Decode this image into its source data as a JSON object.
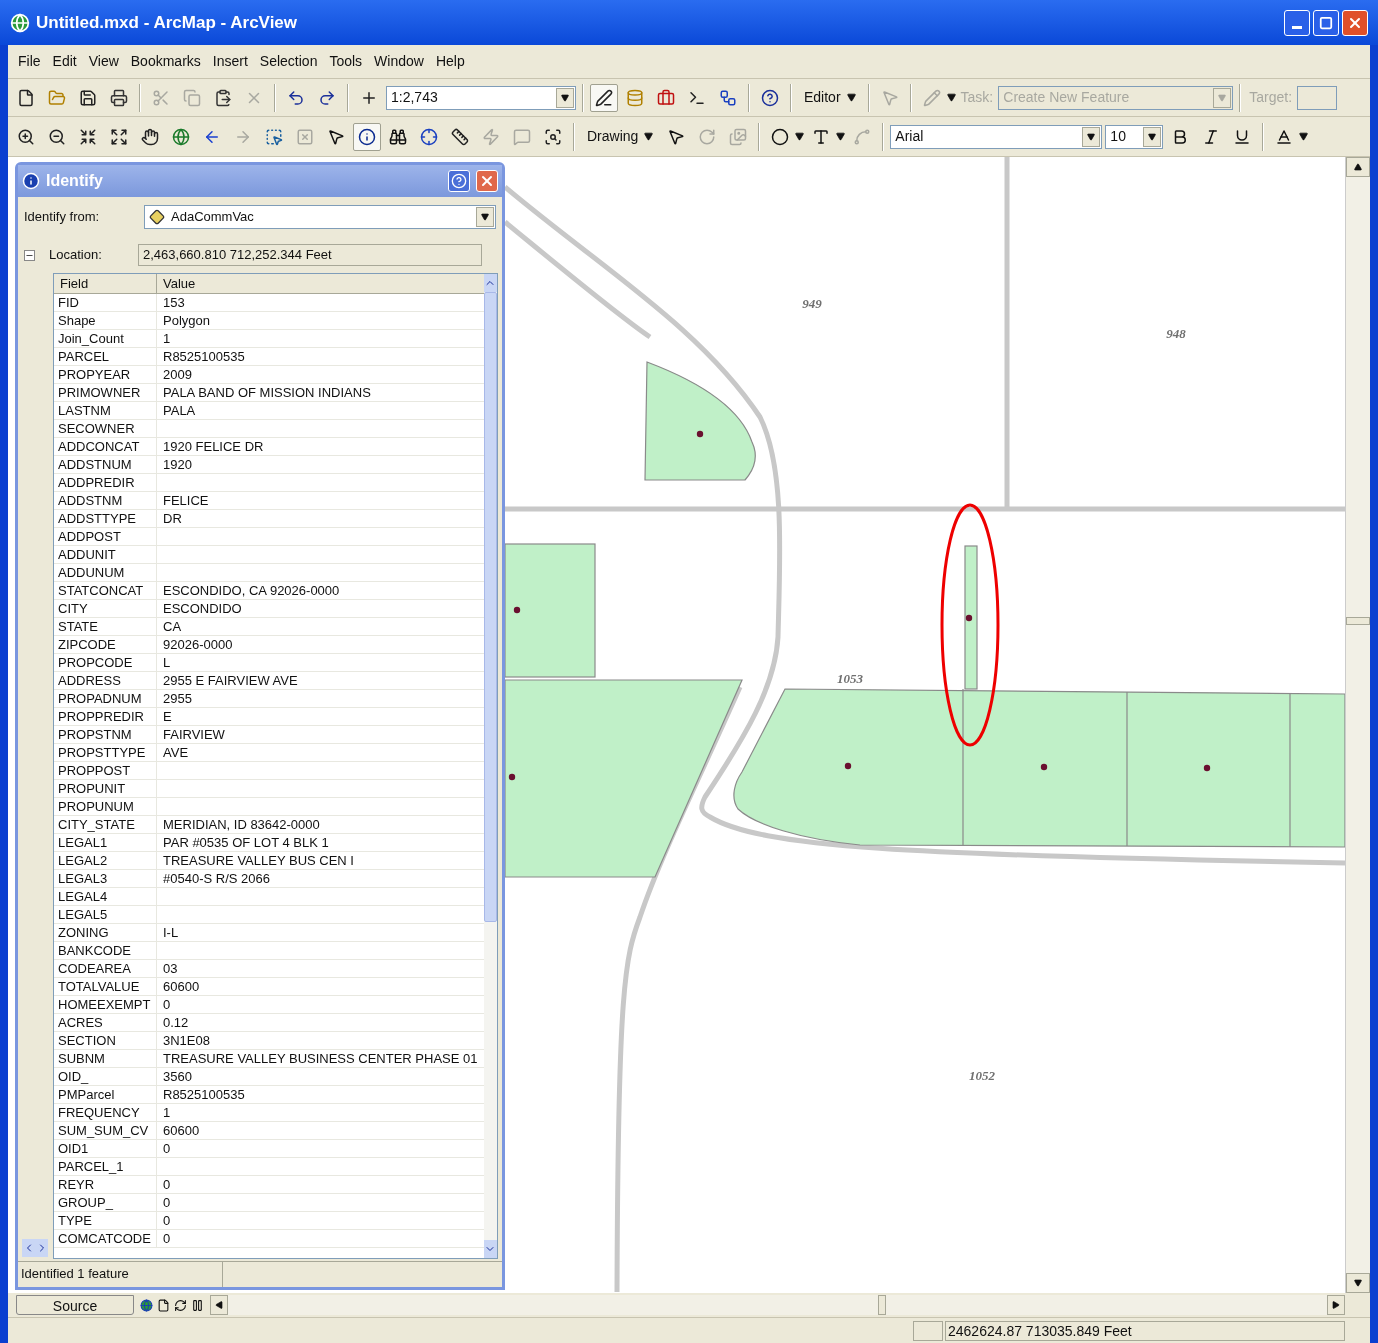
{
  "window": {
    "title": "Untitled.mxd - ArcMap - ArcView"
  },
  "menu": [
    "File",
    "Edit",
    "View",
    "Bookmarks",
    "Insert",
    "Selection",
    "Tools",
    "Window",
    "Help"
  ],
  "toolbars": [
    {
      "items": [
        {
          "kind": "icon",
          "disabled": false,
          "selected": false
        },
        {
          "kind": "icon",
          "disabled": false,
          "selected": false
        },
        {
          "kind": "icon",
          "disabled": false,
          "selected": false
        },
        {
          "kind": "icon",
          "disabled": false,
          "selected": false
        },
        {
          "kind": "sep"
        },
        {
          "kind": "icon",
          "disabled": true,
          "selected": false
        },
        {
          "kind": "icon",
          "disabled": true,
          "selected": false
        },
        {
          "kind": "icon",
          "disabled": false,
          "selected": false
        },
        {
          "kind": "icon",
          "disabled": true,
          "selected": false
        },
        {
          "kind": "sep"
        },
        {
          "kind": "icon",
          "disabled": false,
          "selected": false
        },
        {
          "kind": "icon",
          "disabled": false,
          "selected": false
        },
        {
          "kind": "sep"
        },
        {
          "kind": "icon",
          "disabled": false,
          "selected": false
        },
        {
          "kind": "combo",
          "value": "1:2,743",
          "disabled": false
        },
        {
          "kind": "sep"
        },
        {
          "kind": "icon",
          "disabled": false,
          "selected": true
        },
        {
          "kind": "icon",
          "disabled": false,
          "selected": false
        },
        {
          "kind": "icon",
          "disabled": false,
          "selected": false
        },
        {
          "kind": "icon",
          "disabled": false,
          "selected": false
        },
        {
          "kind": "icon",
          "disabled": false,
          "selected": false
        },
        {
          "kind": "sep"
        },
        {
          "kind": "icon",
          "disabled": false,
          "selected": false
        },
        {
          "kind": "sep"
        },
        {
          "kind": "menu",
          "label": "Editor"
        },
        {
          "kind": "sep"
        },
        {
          "kind": "icon",
          "disabled": true,
          "selected": false
        },
        {
          "kind": "sep"
        },
        {
          "kind": "icon",
          "disabled": true,
          "selected": false
        },
        {
          "kind": "caret"
        },
        {
          "kind": "label",
          "text": "Task:",
          "disabled": true
        },
        {
          "kind": "combo",
          "value": "Create New Feature",
          "disabled": true
        },
        {
          "kind": "sep"
        },
        {
          "kind": "label",
          "text": "Target:",
          "disabled": true
        },
        {
          "kind": "combo",
          "disabled": true
        }
      ]
    },
    {
      "items": [
        {
          "kind": "icon",
          "disabled": false,
          "selected": false
        },
        {
          "kind": "icon",
          "disabled": false,
          "selected": false
        },
        {
          "kind": "icon",
          "disabled": false,
          "selected": false
        },
        {
          "kind": "icon",
          "disabled": false,
          "selected": false
        },
        {
          "kind": "icon",
          "disabled": false,
          "selected": false
        },
        {
          "kind": "icon",
          "disabled": false,
          "selected": false
        },
        {
          "kind": "icon",
          "disabled": false,
          "selected": false
        },
        {
          "kind": "icon",
          "disabled": true,
          "selected": false
        },
        {
          "kind": "icon",
          "disabled": false,
          "selected": false
        },
        {
          "kind": "icon",
          "disabled": true,
          "selected": false
        },
        {
          "kind": "icon",
          "disabled": false,
          "selected": false
        },
        {
          "kind": "icon",
          "disabled": false,
          "selected": true
        },
        {
          "kind": "icon",
          "disabled": false,
          "selected": false
        },
        {
          "kind": "icon",
          "disabled": false,
          "selected": false
        },
        {
          "kind": "icon",
          "disabled": false,
          "selected": false
        },
        {
          "kind": "icon",
          "disabled": true,
          "selected": false
        },
        {
          "kind": "icon",
          "disabled": true,
          "selected": false
        },
        {
          "kind": "icon",
          "disabled": false,
          "selected": false
        },
        {
          "kind": "sep"
        },
        {
          "kind": "menu",
          "label": "Drawing"
        },
        {
          "kind": "icon",
          "disabled": false,
          "selected": false
        },
        {
          "kind": "icon",
          "disabled": true,
          "selected": false
        },
        {
          "kind": "icon",
          "disabled": true,
          "selected": false
        },
        {
          "kind": "sep"
        },
        {
          "kind": "icon",
          "disabled": false,
          "selected": false
        },
        {
          "kind": "caret"
        },
        {
          "kind": "icon",
          "disabled": false,
          "selected": false
        },
        {
          "kind": "caret"
        },
        {
          "kind": "icon",
          "disabled": true,
          "selected": false
        },
        {
          "kind": "sep"
        },
        {
          "kind": "combo",
          "value": "Arial",
          "disabled": false
        },
        {
          "kind": "combo",
          "value": "10",
          "disabled": false
        },
        {
          "kind": "icon",
          "disabled": false,
          "selected": false
        },
        {
          "kind": "icon",
          "disabled": false,
          "selected": false
        },
        {
          "kind": "icon",
          "disabled": false,
          "selected": false
        },
        {
          "kind": "sep"
        },
        {
          "kind": "icon",
          "disabled": false,
          "selected": false
        },
        {
          "kind": "caret"
        }
      ]
    }
  ],
  "identify": {
    "title": "Identify",
    "from_label": "Identify from:",
    "from_value": "AdaCommVac",
    "location_label": "Location:",
    "location_value": "2,463,660.810  712,252.344 Feet",
    "expanded": true,
    "columns": [
      "Field",
      "Value"
    ],
    "rows": [
      {
        "field": "FID",
        "value": "153"
      },
      {
        "field": "Shape",
        "value": "Polygon"
      },
      {
        "field": "Join_Count",
        "value": "1"
      },
      {
        "field": "PARCEL",
        "value": "R8525100535"
      },
      {
        "field": "PROPYEAR",
        "value": "2009"
      },
      {
        "field": "PRIMOWNER",
        "value": "PALA BAND OF MISSION INDIANS"
      },
      {
        "field": "LASTNM",
        "value": "PALA"
      },
      {
        "field": "SECOWNER"
      },
      {
        "field": "ADDCONCAT",
        "value": "1920  FELICE DR"
      },
      {
        "field": "ADDSTNUM",
        "value": "1920"
      },
      {
        "field": "ADDPREDIR"
      },
      {
        "field": "ADDSTNM",
        "value": "FELICE"
      },
      {
        "field": "ADDSTTYPE",
        "value": "DR"
      },
      {
        "field": "ADDPOST"
      },
      {
        "field": "ADDUNIT"
      },
      {
        "field": "ADDUNUM"
      },
      {
        "field": "STATCONCAT",
        "value": "ESCONDIDO, CA 92026-0000"
      },
      {
        "field": "CITY",
        "value": "ESCONDIDO"
      },
      {
        "field": "STATE",
        "value": "CA"
      },
      {
        "field": "ZIPCODE",
        "value": "92026-0000"
      },
      {
        "field": "PROPCODE",
        "value": "L"
      },
      {
        "field": "ADDRESS",
        "value": "2955 E FAIRVIEW AVE"
      },
      {
        "field": "PROPADNUM",
        "value": "2955"
      },
      {
        "field": "PROPPREDIR",
        "value": "E"
      },
      {
        "field": "PROPSTNM",
        "value": "FAIRVIEW"
      },
      {
        "field": "PROPSTTYPE",
        "value": "AVE"
      },
      {
        "field": "PROPPOST"
      },
      {
        "field": "PROPUNIT"
      },
      {
        "field": "PROPUNUM"
      },
      {
        "field": "CITY_STATE",
        "value": "MERIDIAN, ID 83642-0000"
      },
      {
        "field": "LEGAL1",
        "value": "PAR #0535 OF LOT 4 BLK 1"
      },
      {
        "field": "LEGAL2",
        "value": "TREASURE VALLEY BUS CEN I"
      },
      {
        "field": "LEGAL3",
        "value": "#0540-S  R/S 2066"
      },
      {
        "field": "LEGAL4"
      },
      {
        "field": "LEGAL5"
      },
      {
        "field": "ZONING",
        "value": "I-L"
      },
      {
        "field": "BANKCODE"
      },
      {
        "field": "CODEAREA",
        "value": "03"
      },
      {
        "field": "TOTALVALUE",
        "value": "60600"
      },
      {
        "field": "HOMEEXEMPT",
        "value": "0"
      },
      {
        "field": "ACRES",
        "value": "0.12"
      },
      {
        "field": "SECTION",
        "value": "3N1E08"
      },
      {
        "field": "SUBNM",
        "value": "TREASURE VALLEY BUSINESS CENTER PHASE 01"
      },
      {
        "field": "OID_",
        "value": "3560"
      },
      {
        "field": "PMParcel",
        "value": "R8525100535"
      },
      {
        "field": "FREQUENCY",
        "value": "1"
      },
      {
        "field": "SUM_SUM_CV",
        "value": "60600"
      },
      {
        "field": "OID1",
        "value": "0"
      },
      {
        "field": "PARCEL_1"
      },
      {
        "field": "REYR",
        "value": "0"
      },
      {
        "field": "GROUP_",
        "value": "0"
      },
      {
        "field": "TYPE",
        "value": "0"
      },
      {
        "field": "COMCATCODE",
        "value": "0"
      }
    ],
    "status": "Identified 1 feature"
  },
  "map": {
    "labels": [
      "949",
      "948",
      "1053",
      "1052"
    ]
  },
  "bottom_tab": "Source",
  "status_bar": {
    "coordinates": "2462624.87  713035.849 Feet"
  }
}
